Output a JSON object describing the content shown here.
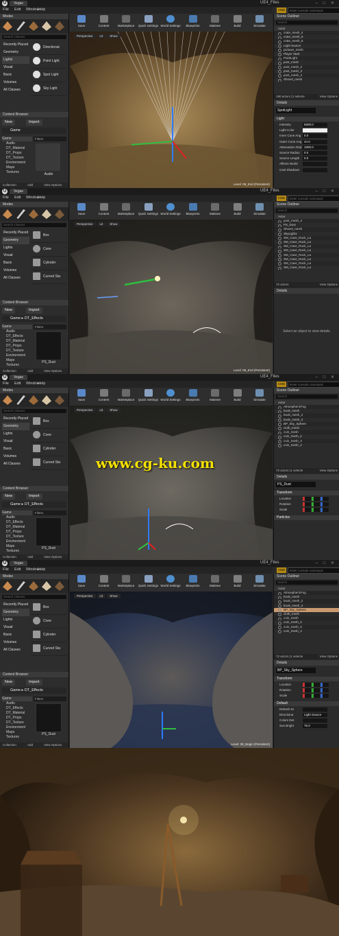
{
  "app": {
    "title": "UE4_Files",
    "level_tab": "Vegas",
    "logo": "U",
    "console_placeholder": "Enter console command",
    "console_tag": "CMD"
  },
  "menu": [
    "File",
    "Edit",
    "Window",
    "Help"
  ],
  "modes": {
    "title": "Modes",
    "search_placeholder": "Search Classes",
    "categories": [
      "Recently Placed",
      "Geometry",
      "Lights",
      "Visual",
      "Basic",
      "Volumes",
      "All Classes"
    ]
  },
  "toolbar": [
    "Save",
    "Content",
    "Marketplace",
    "Quick Settings",
    "World Settings",
    "Blueprints",
    "Matinee",
    "Build",
    "Simulate"
  ],
  "viewport_controls": [
    "Perspective",
    "Lit",
    "Show"
  ],
  "content_browser": {
    "title": "Content Browser",
    "new": "New",
    "import": "Import",
    "filters": "Filters",
    "view_options": "View Options",
    "collections": "Collection",
    "add": "Add"
  },
  "outliner": {
    "title": "Scene Outliner",
    "search_placeholder": "Search",
    "column": "Actor",
    "view_options": "View Options"
  },
  "details": {
    "title": "Details"
  },
  "screens": [
    {
      "level_name": "Level: 08_End (Persistent)",
      "place_category_selected": "Lights",
      "place_items": [
        "Directional",
        "Point Light",
        "Spot Light",
        "Sky Light"
      ],
      "path": [
        "Game"
      ],
      "tree": [
        "Game",
        "Audio",
        "DT_Material",
        "DT_Props",
        "DT_Texture",
        "Environment",
        "Maps",
        "Textures"
      ],
      "asset": "Audio",
      "outliner_items": [
        "crate_mesh_4",
        "crate_mesh_5",
        "crate_mesh_6",
        "Light Source",
        "pickaxe_mesh",
        "Player Start",
        "PointLight",
        "post_mesh",
        "post_mesh_2",
        "post_mesh_3",
        "post_mesh_4",
        "Shovel_mesh"
      ],
      "outliner_selected": -1,
      "actor_count": "190 actors (1 selecte",
      "detail_name": "SpotLight",
      "detail_section": "Light",
      "detail_rows": [
        {
          "k": "Intensity",
          "v": "5000.0"
        },
        {
          "k": "Light Color",
          "v": ""
        },
        {
          "k": "Inner Cone Ang",
          "v": "0.0"
        },
        {
          "k": "Outer Cone Ang",
          "v": "44.0"
        },
        {
          "k": "Attenuation Rad",
          "v": "1000.0"
        },
        {
          "k": "Source Radius",
          "v": "0.0"
        },
        {
          "k": "Source Length",
          "v": "0.0"
        },
        {
          "k": "Affects World",
          "v": ""
        },
        {
          "k": "Cast Shadows",
          "v": ""
        }
      ]
    },
    {
      "level_name": "Level: 08_End (Persistent)",
      "place_category_selected": "Geometry",
      "place_items": [
        "Box",
        "Cone",
        "Cylinder",
        "Curved Sta"
      ],
      "path": [
        "Game",
        "DT_Effects"
      ],
      "tree": [
        "Game",
        "Audio",
        "DT_Effects",
        "DT_Material",
        "DT_Props",
        "DT_Texture",
        "Environment",
        "Maps",
        "Textures"
      ],
      "asset": "PS_Dust",
      "outliner_items": [
        "post_mesh_4",
        "PS_Dust",
        "Shovel_mesh",
        "SkyLight1",
        "SM_Cave_Rock_La",
        "SM_Cave_Rock_La",
        "SM_Cave_Rock_La",
        "SM_Cave_Rock_La",
        "SM_Cave_Rock_La",
        "SM_Cave_Rock_La",
        "SM_Cave_Rock_La",
        "SM_Cave_Rock_La"
      ],
      "outliner_selected": -1,
      "actor_count": "72 actors",
      "detail_empty": "Select an object to view details."
    },
    {
      "level_name": "",
      "place_category_selected": "Geometry",
      "place_items": [
        "Box",
        "Cone",
        "Cylinder",
        "Curved Sta"
      ],
      "path": [
        "Game",
        "DT_Effects"
      ],
      "tree": [
        "Game",
        "Audio",
        "DT_Effects",
        "DT_Material",
        "DT_Props",
        "DT_Texture",
        "Environment",
        "Maps",
        "Textures"
      ],
      "asset": "PS_Dust",
      "outliner_items": [
        "AtmosphericFog",
        "book_mesh",
        "book_mesh_2",
        "book_mesh_3",
        "BP_Sky_Sphere",
        "cloth_mesh",
        "coin_mesh",
        "coin_mesh_2",
        "coin_mesh_3",
        "coin_mesh_4"
      ],
      "outliner_selected": -1,
      "actor_count": "72 actors (1 selecte",
      "detail_name": "PS_Dust",
      "detail_section": "Transform",
      "detail_rows": [
        {
          "k": "Location",
          "v": ""
        },
        {
          "k": "Rotation",
          "v": ""
        },
        {
          "k": "Scale",
          "v": ""
        }
      ],
      "detail_section2": "Particles"
    },
    {
      "level_name": "Level: 08_Begin (Persistent)",
      "place_category_selected": "Geometry",
      "place_items": [
        "Box",
        "Cone",
        "Cylinder",
        "Curved Sta"
      ],
      "path": [
        "Game",
        "DT_Effects"
      ],
      "tree": [
        "Game",
        "Audio",
        "DT_Effects",
        "DT_Material",
        "DT_Props",
        "DT_Texture",
        "Environment",
        "Maps",
        "Textures"
      ],
      "asset": "PS_Dust",
      "outliner_items": [
        "AtmosphericFog",
        "book_mesh",
        "book_mesh_2",
        "book_mesh_3",
        "BP_Sky_Sphere",
        "cloth_mesh",
        "coin_mesh",
        "coin_mesh_2",
        "coin_mesh_3",
        "coin_mesh_4"
      ],
      "outliner_selected": 4,
      "actor_count": "72 actors (1 selecte",
      "detail_name": "BP_Sky_Sphere",
      "detail_section": "Transform",
      "detail_rows": [
        {
          "k": "Location",
          "v": ""
        },
        {
          "k": "Rotation",
          "v": ""
        },
        {
          "k": "Scale",
          "v": ""
        }
      ],
      "detail_section2": "Default",
      "detail_rows2": [
        {
          "k": "Refresh M",
          "v": ""
        },
        {
          "k": "Directiona",
          "v": "Light Source"
        },
        {
          "k": "Colors Det",
          "v": ""
        },
        {
          "k": "Sun Bright",
          "v": "75.0"
        }
      ]
    }
  ],
  "watermark": "www.cg-ku.com",
  "colors": {
    "accent": "#b58a12",
    "selection": "#c99a70",
    "panel": "#2a2a2a",
    "watermark": "#f4e100"
  }
}
